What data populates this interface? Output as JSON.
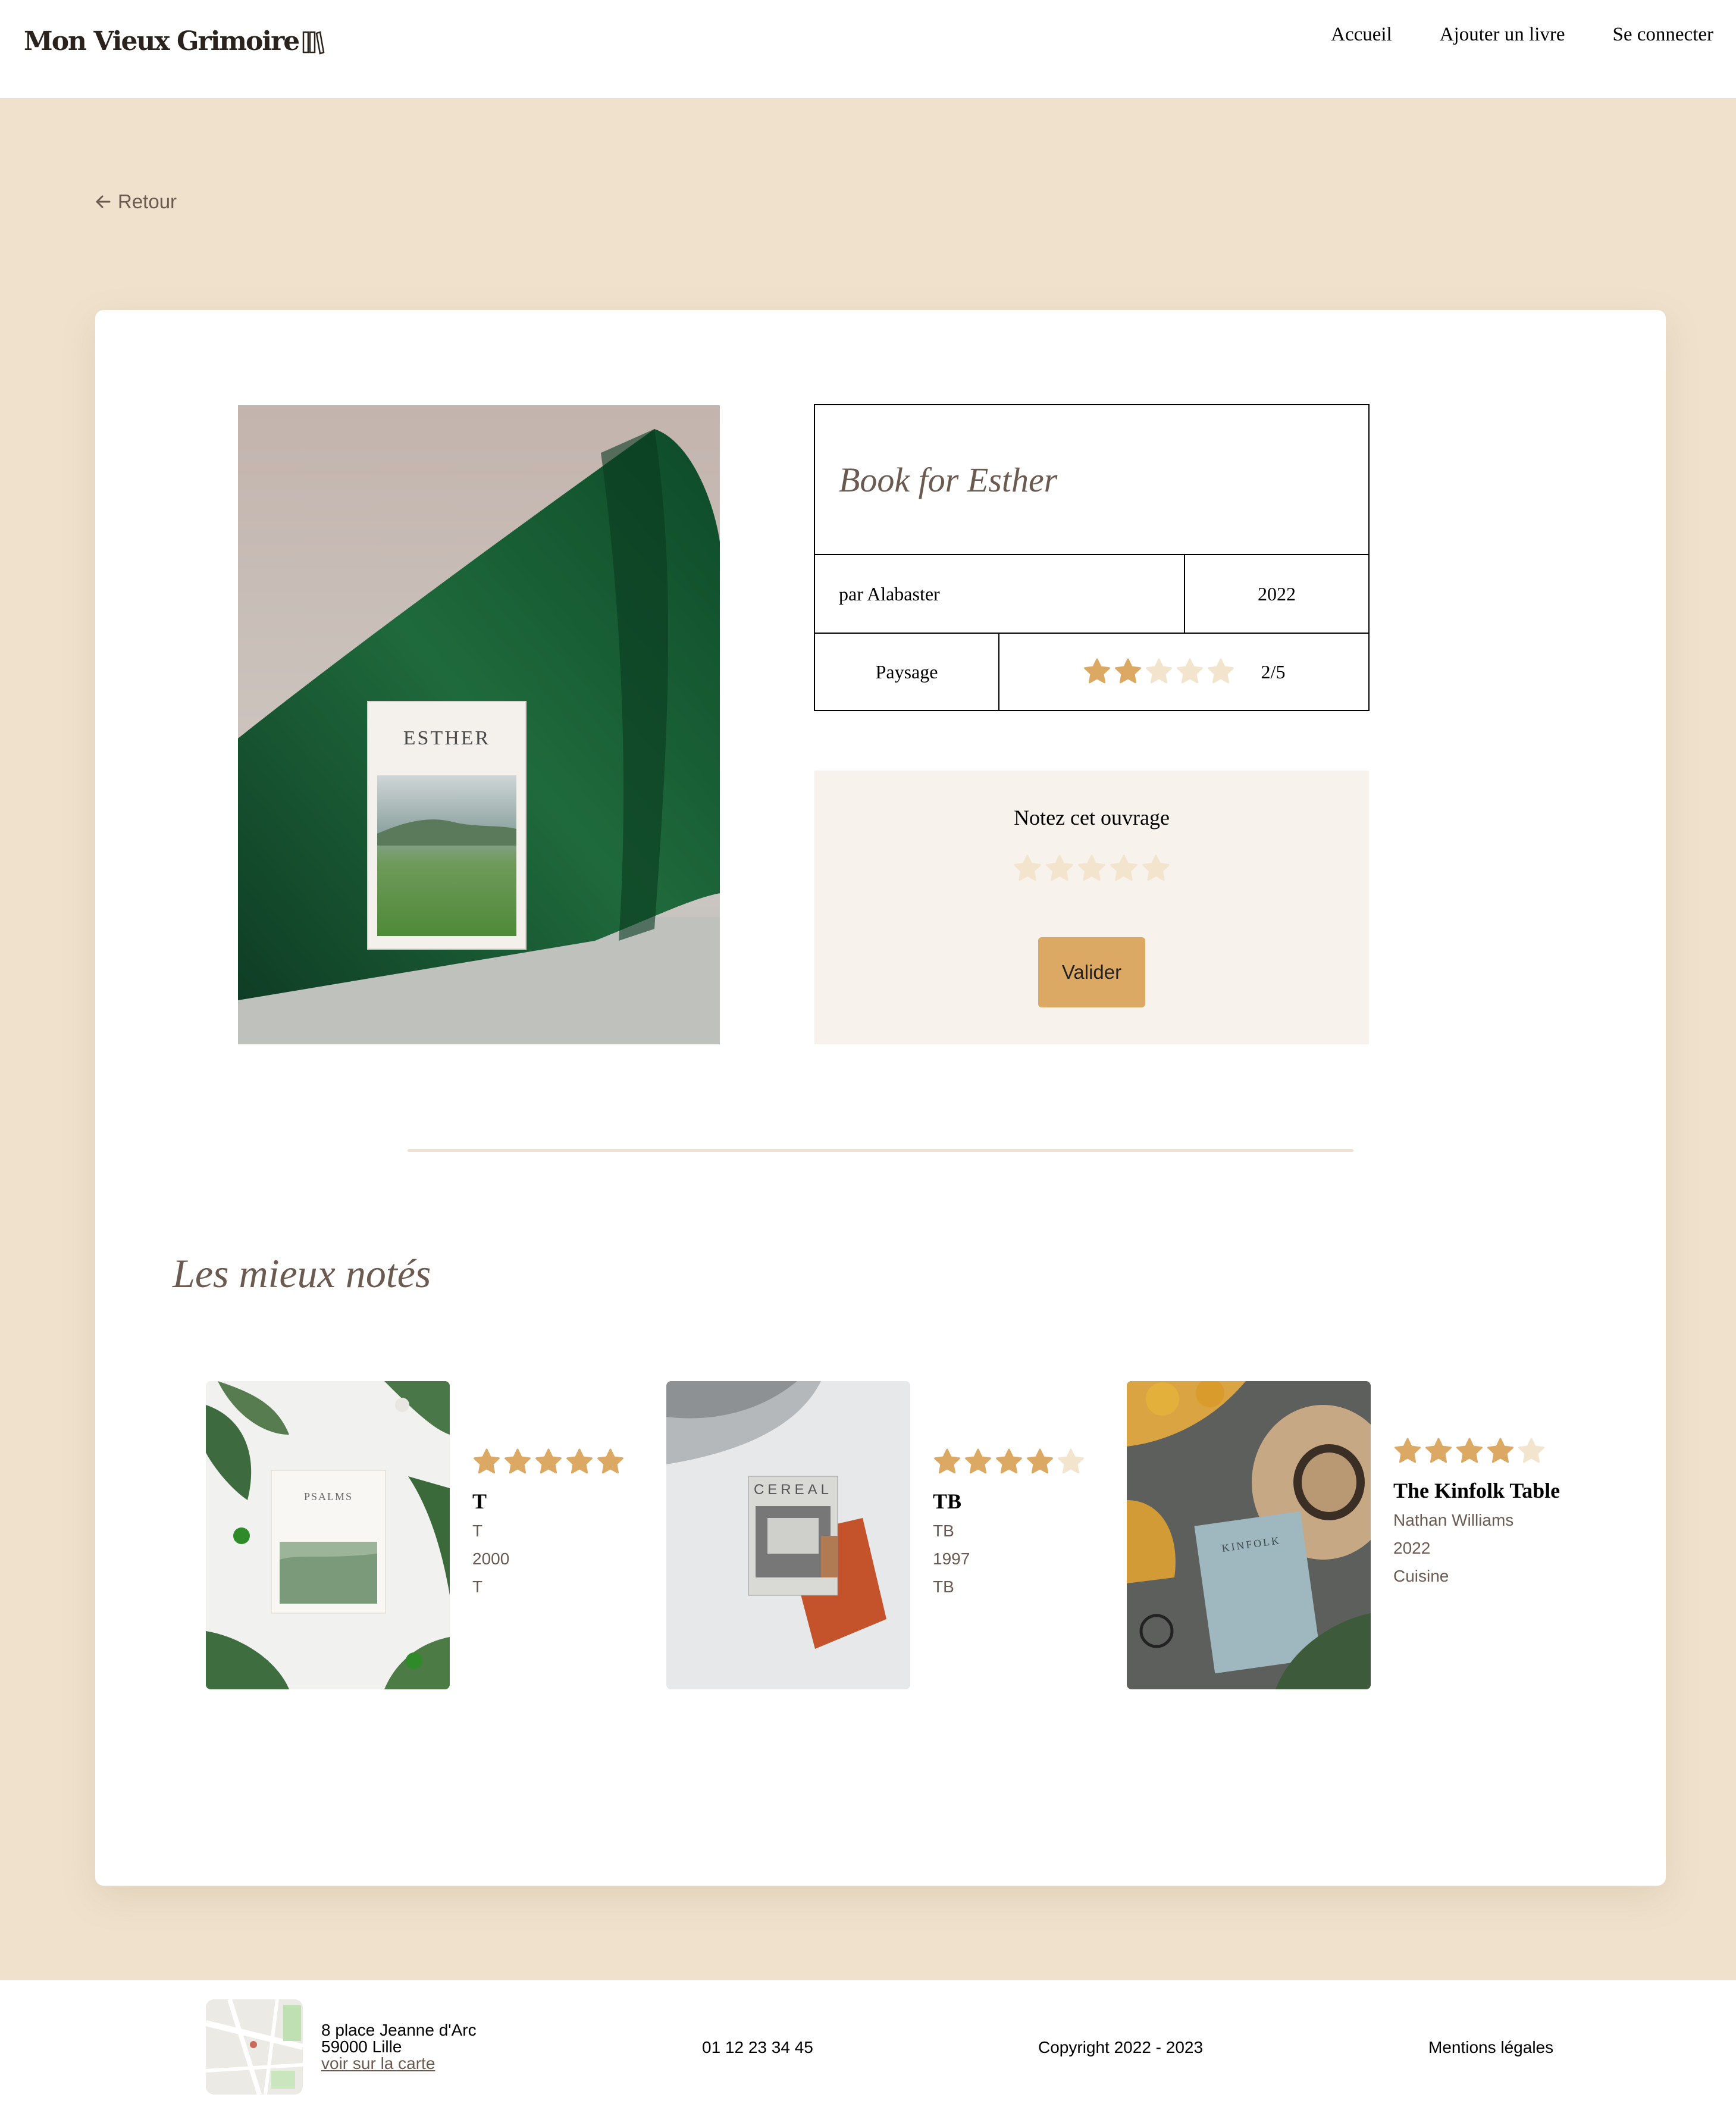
{
  "header": {
    "logo": "Mon Vieux Grimoire",
    "nav": [
      "Accueil",
      "Ajouter un livre",
      "Se connecter"
    ]
  },
  "back_label": "Retour",
  "book": {
    "title": "Book for Esther",
    "cover_text": "ESTHER",
    "author": "par Alabaster",
    "year": "2022",
    "genre": "Paysage",
    "rating": 2,
    "rating_text": "2/5"
  },
  "rate": {
    "title": "Notez cet ouvrage",
    "button": "Valider"
  },
  "top_rated": {
    "title": "Les mieux notés",
    "books": [
      {
        "title": "T",
        "author": "T",
        "year": "2000",
        "genre": "T",
        "rating": 5,
        "cover_text": "PSALMS"
      },
      {
        "title": "TB",
        "author": "TB",
        "year": "1997",
        "genre": "TB",
        "rating": 4,
        "cover_text": "CEREAL"
      },
      {
        "title": "The Kinfolk Table",
        "author": "Nathan Williams",
        "year": "2022",
        "genre": "Cuisine",
        "rating": 4,
        "cover_text": "KINFOLK"
      }
    ]
  },
  "footer": {
    "address_line1": "8 place Jeanne d'Arc",
    "address_line2": "59000 Lille",
    "map_link": "voir sur la carte",
    "phone": "01 12 23 34 45",
    "copyright": "Copyright 2022 - 2023",
    "legal": "Mentions légales"
  },
  "colors": {
    "background": "#efe1cc",
    "accent": "#dba963",
    "star_empty": "#f3e4ce",
    "text_brown": "#6b5a4f"
  }
}
